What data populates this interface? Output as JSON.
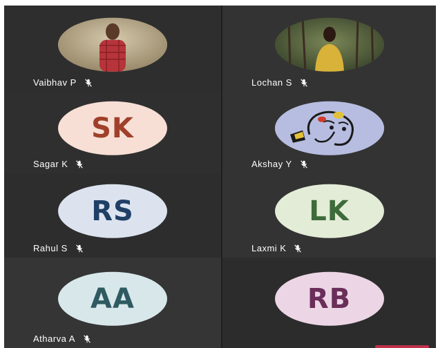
{
  "participants": [
    {
      "name": "Vaibhav P",
      "avatar_type": "photo",
      "photo_desc": "person in red checked shirt",
      "avatar_bg": "#b9a98a"
    },
    {
      "name": "Lochan S",
      "avatar_type": "photo",
      "photo_desc": "person in yellow shirt outdoors",
      "avatar_bg": "#4d5a3e"
    },
    {
      "name": "Sagar K",
      "avatar_type": "initials",
      "initials": "SK",
      "avatar_bg": "#f7dfd6",
      "initials_color": "#a0402a"
    },
    {
      "name": "Akshay Y",
      "avatar_type": "drawing",
      "photo_desc": "ganesha sketch",
      "avatar_bg": "#b7bde0"
    },
    {
      "name": "Rahul S",
      "avatar_type": "initials",
      "initials": "RS",
      "avatar_bg": "#dce3ef",
      "initials_color": "#1f3f66"
    },
    {
      "name": "Laxmi K",
      "avatar_type": "initials",
      "initials": "LK",
      "avatar_bg": "#e3ecd7",
      "initials_color": "#3d6b3a"
    },
    {
      "name": "Atharva A",
      "avatar_type": "initials",
      "initials": "AA",
      "avatar_bg": "#d8e8ea",
      "initials_color": "#2f5a61"
    },
    {
      "name": "",
      "avatar_type": "initials",
      "initials": "RB",
      "avatar_bg": "#ecd6e6",
      "initials_color": "#6a2e5a"
    }
  ],
  "icons": {
    "mic": "mic-off-icon"
  },
  "colors": {
    "tile_bg": "#2e2e2e",
    "name_text": "#ffffff",
    "accent": "#c0304a"
  }
}
